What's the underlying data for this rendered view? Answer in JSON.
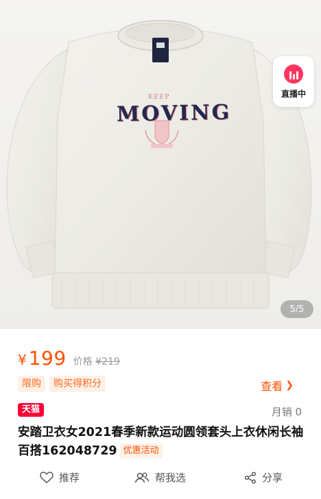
{
  "hero": {
    "shirt_print": {
      "top": "KEEP",
      "main": "MOVING"
    },
    "live_badge": {
      "label": "直播中"
    },
    "pager": "5/5"
  },
  "price": {
    "currency": "¥",
    "value": "199",
    "original_label": "价格",
    "original_currency": "¥",
    "original_value": "219"
  },
  "tags": [
    "限购",
    "购买得积分"
  ],
  "view_more": {
    "label": "查看",
    "chevron": "❯"
  },
  "store_badge": "天猫",
  "sales": "月销 0",
  "product": {
    "title": "安踏卫衣女2021春季新款运动圆领套头上衣休闲长袖百搭162048729",
    "promo": "优惠活动"
  },
  "actions": {
    "recommend": "推荐",
    "help_choose": "帮我选",
    "share": "分享"
  },
  "colors": {
    "accent": "#ff5000",
    "tmall": "#ff0036",
    "live": "#ff3560"
  }
}
